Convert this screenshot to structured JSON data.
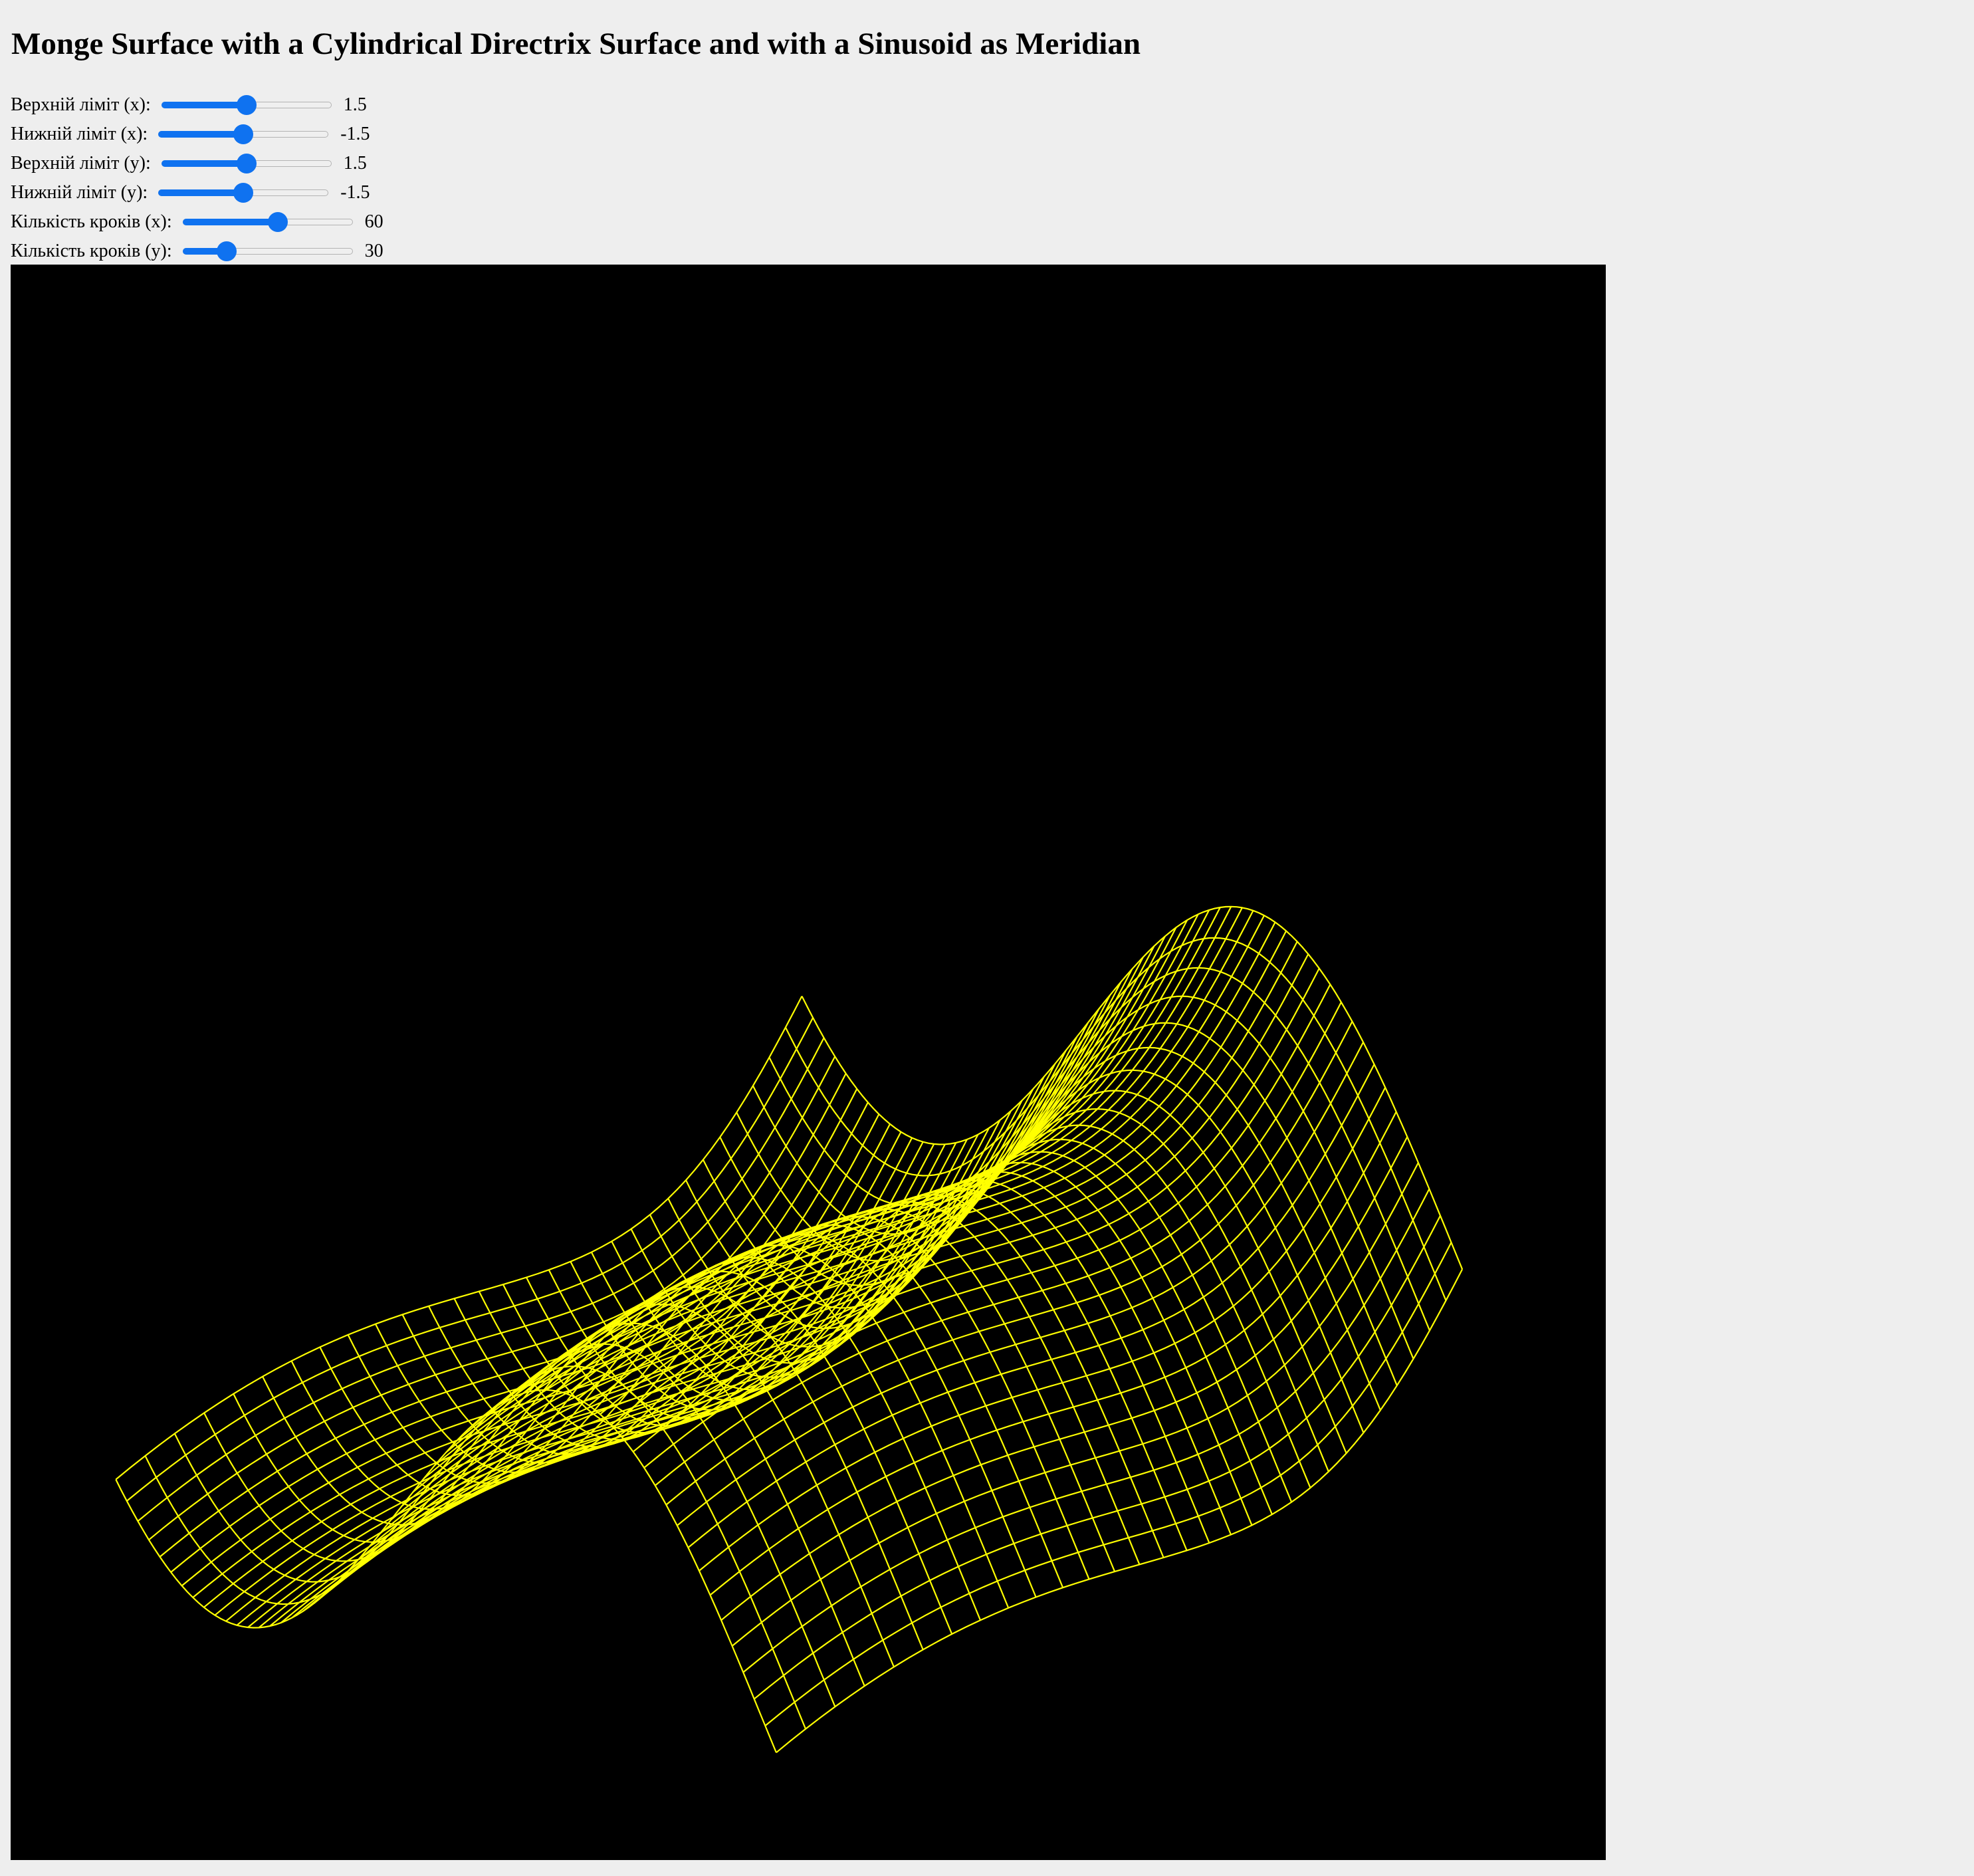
{
  "page": {
    "title": "Monge Surface with a Cylindrical Directrix Surface and with a Sinusoid as Meridian"
  },
  "controls": [
    {
      "label": "Верхній ліміт (x):",
      "value": "1.5",
      "fraction": 0.5
    },
    {
      "label": "Нижній ліміт (x):",
      "value": "-1.5",
      "fraction": 0.5
    },
    {
      "label": "Верхній ліміт (y):",
      "value": "1.5",
      "fraction": 0.5
    },
    {
      "label": "Нижній ліміт (y):",
      "value": "-1.5",
      "fraction": 0.5
    },
    {
      "label": "Кількість кроків (x):",
      "value": "60",
      "fraction": 0.56
    },
    {
      "label": "Кількість кроків (y):",
      "value": "30",
      "fraction": 0.26
    }
  ],
  "surface": {
    "color": "#ffff00",
    "background": "#000000",
    "steps_x": 60,
    "steps_y": 30
  }
}
